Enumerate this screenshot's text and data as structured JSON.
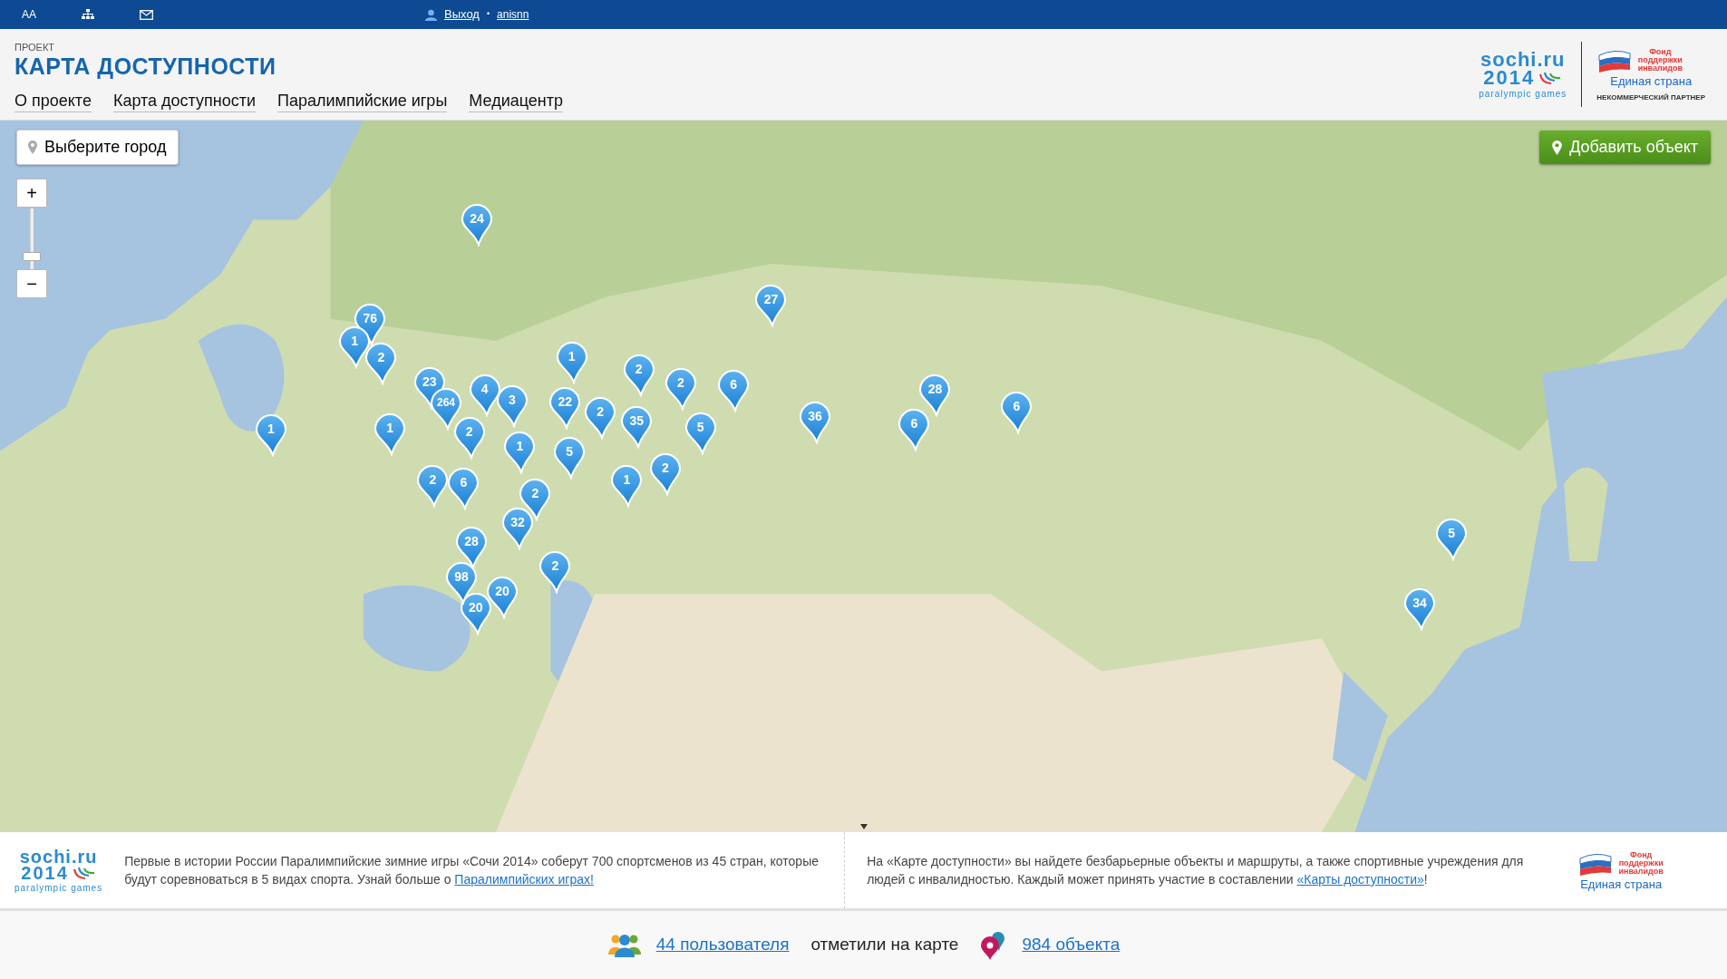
{
  "top_bar": {
    "font_size_label": "AA",
    "logout": "Выход",
    "separator": "•",
    "username": "anisnn"
  },
  "header": {
    "kicker": "ПРОЕКТ",
    "title": "КАРТА ДОСТУПНОСТИ",
    "nav": [
      "О проекте",
      "Карта доступности",
      "Паралимпийские игры",
      "Медиацентр"
    ],
    "logo_sochi": {
      "line1": "sochi.ru",
      "line2": "2014",
      "line3": "paralympic games"
    },
    "logo_partner": {
      "line1": "Фонд поддержки инвалидов",
      "line2": "Единая страна",
      "line3": "НЕКОММЕРЧЕСКИЙ ПАРТНЕР"
    }
  },
  "map": {
    "city_button": "Выберите город",
    "add_button": "Добавить объект",
    "zoom_in": "+",
    "zoom_out": "−",
    "zoom": {
      "level": 0.2
    },
    "markers": [
      {
        "count": "24"
      },
      {
        "count": "27"
      },
      {
        "count": "76"
      },
      {
        "count": "1"
      },
      {
        "count": "2"
      },
      {
        "count": "23"
      },
      {
        "count": "4"
      },
      {
        "count": "264"
      },
      {
        "count": "3"
      },
      {
        "count": "22"
      },
      {
        "count": "2"
      },
      {
        "count": "35"
      },
      {
        "count": "1"
      },
      {
        "count": "2"
      },
      {
        "count": "2"
      },
      {
        "count": "6"
      },
      {
        "count": "5"
      },
      {
        "count": "36"
      },
      {
        "count": "28"
      },
      {
        "count": "6"
      },
      {
        "count": "6"
      },
      {
        "count": "1"
      },
      {
        "count": "1"
      },
      {
        "count": "2"
      },
      {
        "count": "1"
      },
      {
        "count": "5"
      },
      {
        "count": "2"
      },
      {
        "count": "1"
      },
      {
        "count": "2"
      },
      {
        "count": "2"
      },
      {
        "count": "6"
      },
      {
        "count": "32"
      },
      {
        "count": "28"
      },
      {
        "count": "20"
      },
      {
        "count": "98"
      },
      {
        "count": "20"
      },
      {
        "count": "2"
      },
      {
        "count": "5"
      },
      {
        "count": "34"
      }
    ]
  },
  "info": {
    "logo_sochi": {
      "line1": "sochi.ru",
      "line2": "2014",
      "line3": "paralympic games"
    },
    "logo_partner": {
      "line1": "Фонд поддержки инвалидов",
      "line2": "Единая страна"
    },
    "left": {
      "text": "Первые в истории России Паралимпийские зимние игры «Сочи 2014» соберут 700 спортсменов из 45 стран, которые будут соревноваться в 5 видах спорта. Узнай больше о ",
      "link": "Паралимпийских играх!"
    },
    "right": {
      "text": "На «Карте доступности» вы найдете безбарьерные объекты и маршруты, а также спортивные учреждения для людей с инвалидностью. Каждый может принять участие в составлении ",
      "link": "«Карты доступности»",
      "after": "!"
    }
  },
  "stats": {
    "users_link": "44 пользователя",
    "middle": "отметили на карте",
    "objects_link": "984 объекта"
  }
}
